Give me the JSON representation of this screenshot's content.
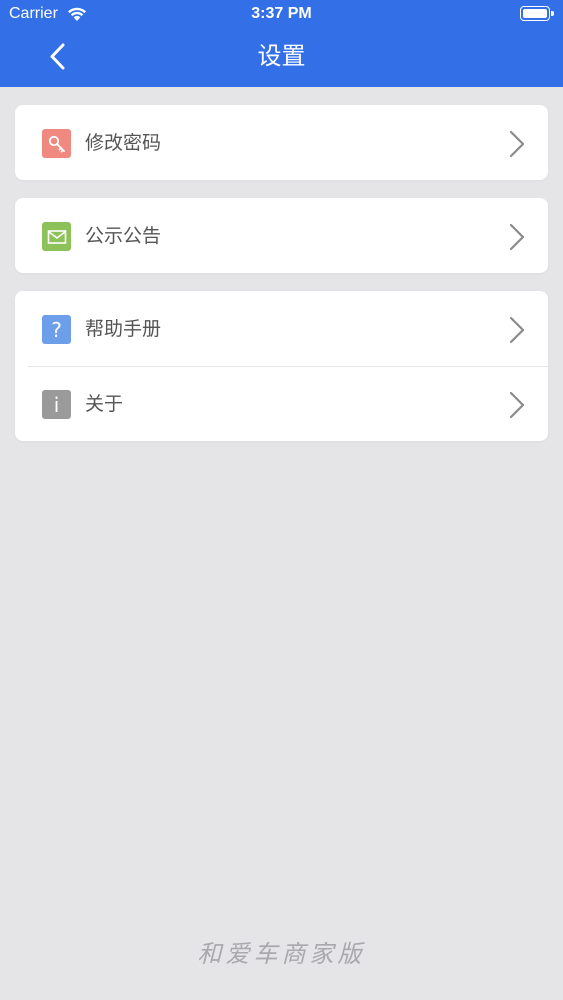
{
  "status_bar": {
    "carrier": "Carrier",
    "time": "3:37 PM"
  },
  "header": {
    "title": "设置"
  },
  "groups": [
    {
      "items": [
        {
          "label": "修改密码",
          "icon": "key-icon",
          "color": "#f08a80"
        }
      ]
    },
    {
      "items": [
        {
          "label": "公示公告",
          "icon": "envelope-icon",
          "color": "#8dc15a"
        }
      ]
    },
    {
      "items": [
        {
          "label": "帮助手册",
          "icon": "question-icon",
          "color": "#6d9eea",
          "glyph": "?"
        },
        {
          "label": "关于",
          "icon": "info-icon",
          "color": "#9a9a9a",
          "glyph": "i"
        }
      ]
    }
  ],
  "footer": {
    "logo_text": "和爱车商家版"
  }
}
